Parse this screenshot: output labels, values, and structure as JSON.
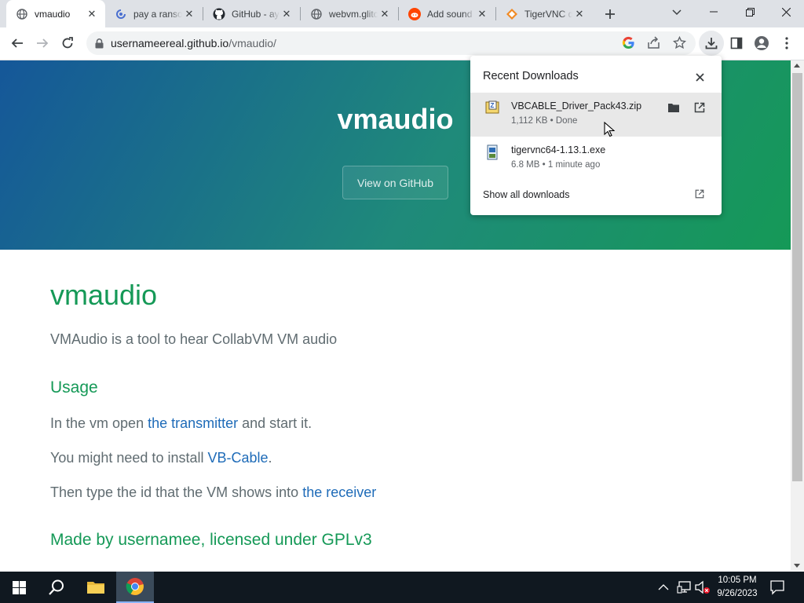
{
  "tabs": [
    {
      "title": "vmaudio",
      "icon": "globe-icon",
      "active": true
    },
    {
      "title": "pay a ransom",
      "icon": "spiral-icon",
      "active": false
    },
    {
      "title": "GitHub - ayunami",
      "icon": "github-icon",
      "active": false
    },
    {
      "title": "webvm.glitch.me",
      "icon": "globe-icon",
      "active": false
    },
    {
      "title": "Add sound to VM",
      "icon": "reddit-icon",
      "active": false
    },
    {
      "title": "TigerVNC download",
      "icon": "tigervnc-icon",
      "active": false
    }
  ],
  "toolbar": {
    "url_domain": "usernameereal.github.io",
    "url_path": "/vmaudio/"
  },
  "page": {
    "hero_title": "vmaudio",
    "github_button": "View on GitHub",
    "heading": "vmaudio",
    "description": "VMAudio is a tool to hear CollabVM VM audio",
    "usage_heading": "Usage",
    "line1_pre": "In the vm open ",
    "line1_link": "the transmitter",
    "line1_post": " and start it.",
    "line2_pre": "You might need to install ",
    "line2_link": "VB-Cable",
    "line2_post": ".",
    "line3_pre": "Then type the id that the VM shows into ",
    "line3_link": "the receiver",
    "footer": "Made by usernamee, licensed under GPLv3"
  },
  "downloads": {
    "title": "Recent Downloads",
    "items": [
      {
        "name": "VBCABLE_Driver_Pack43.zip",
        "info": "1,112 KB • Done",
        "icon": "zip-file-icon"
      },
      {
        "name": "tigervnc64-1.13.1.exe",
        "info": "6.8 MB • 1 minute ago",
        "icon": "exe-file-icon"
      }
    ],
    "show_all": "Show all downloads"
  },
  "taskbar": {
    "time": "10:05 PM",
    "date": "9/26/2023"
  },
  "colors": {
    "accent_green": "#159957",
    "link_blue": "#1e6bb8",
    "hero_start": "#155799",
    "hero_end": "#159957"
  }
}
